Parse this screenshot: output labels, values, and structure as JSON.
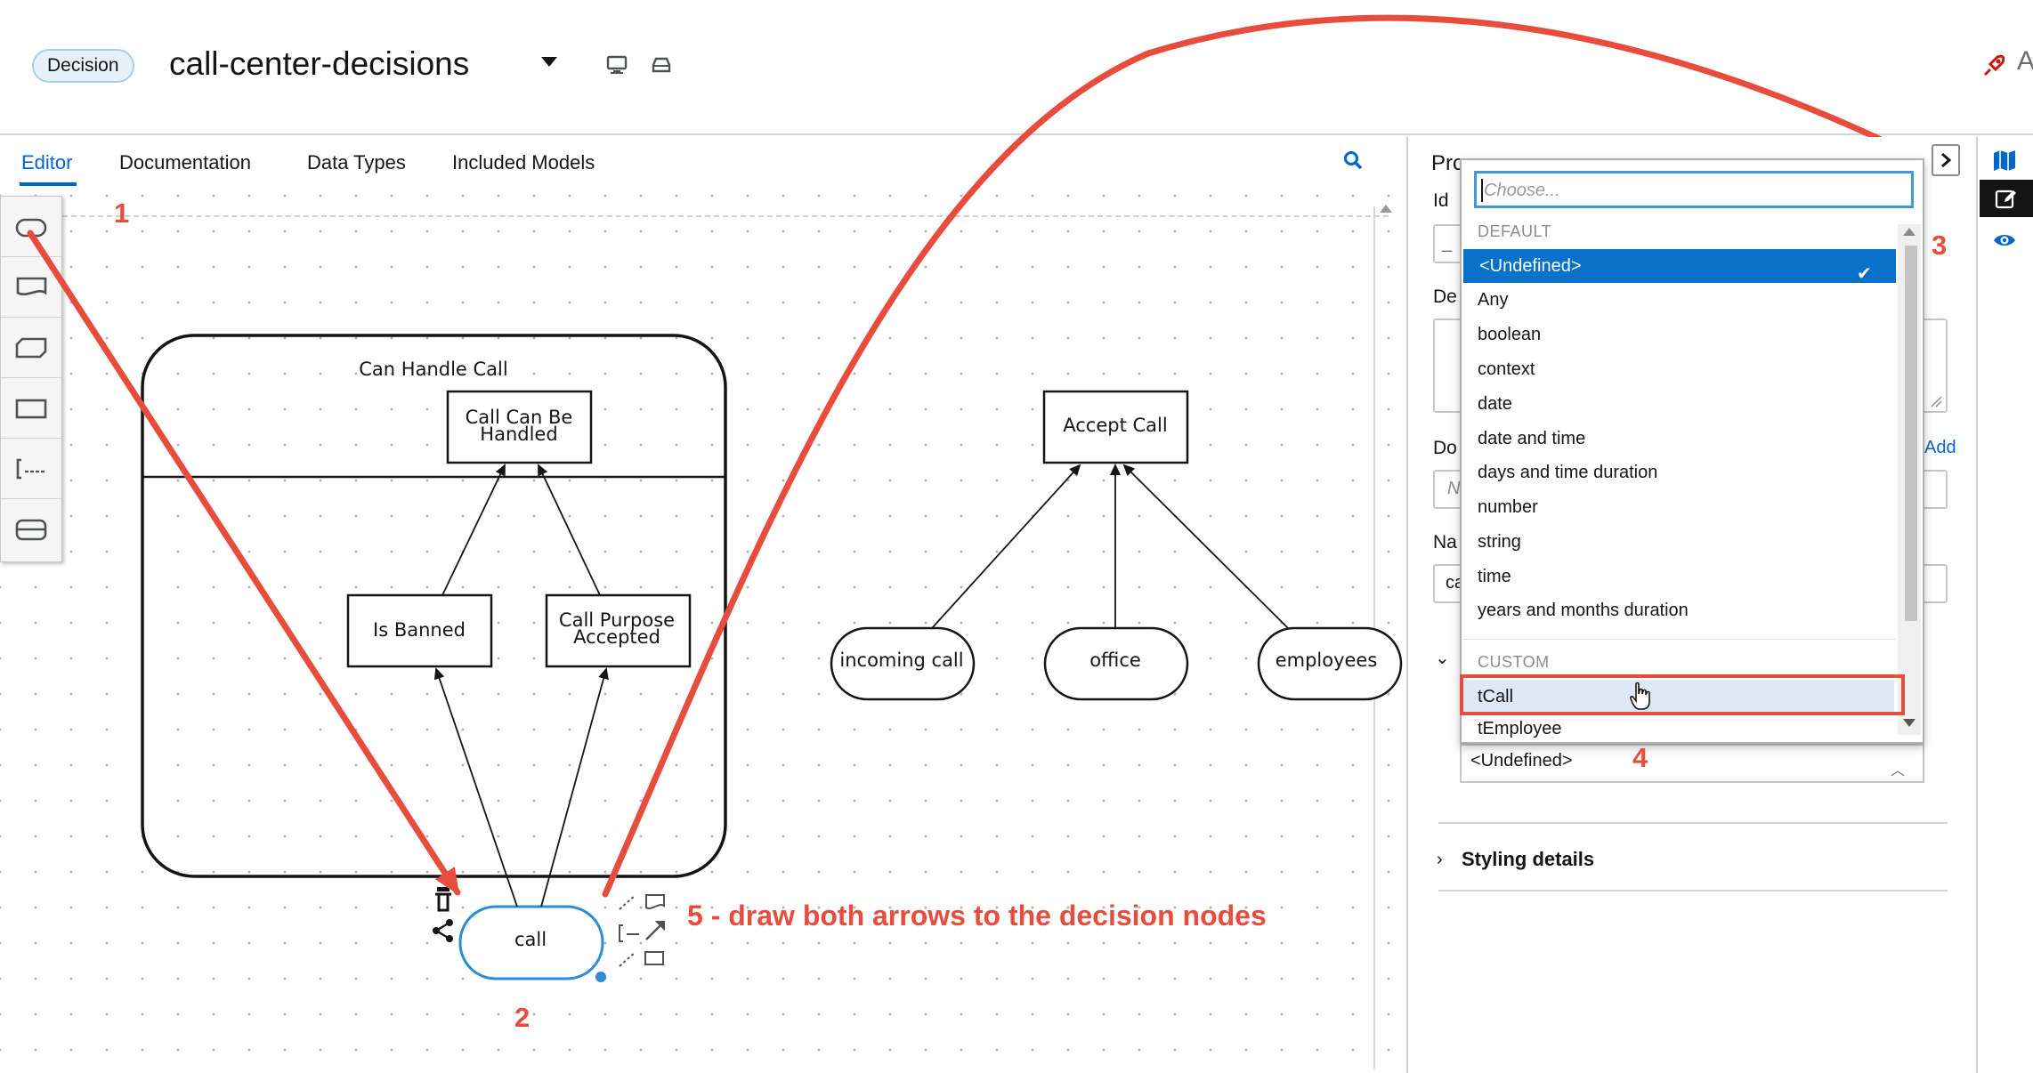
{
  "header": {
    "badge": "Decision",
    "title": "call-center-decisions",
    "right_text": "A"
  },
  "tabs": [
    {
      "label": "Editor",
      "active": true
    },
    {
      "label": "Documentation",
      "active": false
    },
    {
      "label": "Data Types",
      "active": false
    },
    {
      "label": "Included Models",
      "active": false
    }
  ],
  "palette": {
    "items": [
      "input-data-tool",
      "knowledge-source-tool",
      "business-knowledge-model-tool",
      "decision-tool",
      "text-annotation-tool",
      "decision-service-tool"
    ]
  },
  "diagram": {
    "decision_service": {
      "name": "Can Handle Call"
    },
    "decisions": [
      {
        "name_line1": "Call Can Be",
        "name_line2": "Handled"
      },
      {
        "name": "Is Banned"
      },
      {
        "name_line1": "Call Purpose",
        "name_line2": "Accepted"
      },
      {
        "name": "Accept Call"
      }
    ],
    "inputs": [
      "incoming call",
      "office",
      "employees",
      "call"
    ]
  },
  "properties": {
    "title": "Pro",
    "labels": [
      "Id",
      "De",
      "Do",
      "Na"
    ],
    "id_value": "_",
    "doc_placeholder": "N",
    "name_value": "ca",
    "add_link": "Add",
    "styling_details": "Styling details",
    "type_select_value": "<Undefined>"
  },
  "dropdown": {
    "placeholder": "Choose...",
    "group_default": "DEFAULT",
    "default_items": [
      "<Undefined>",
      "Any",
      "boolean",
      "context",
      "date",
      "date and time",
      "days and time duration",
      "number",
      "string",
      "time",
      "years and months duration"
    ],
    "selected": "<Undefined>",
    "group_custom": "CUSTOM",
    "custom_items": [
      "tCall",
      "tEmployee"
    ],
    "hovered": "tCall"
  },
  "annotations": {
    "step1": "1",
    "step2": "2",
    "step3": "3",
    "step4": "4",
    "step5": "5 - draw both arrows to the decision nodes",
    "color": "#e74c3c"
  },
  "colors": {
    "accent": "#0066cc",
    "selected_item": "#0a71c8",
    "annotation": "#e74c3c"
  }
}
